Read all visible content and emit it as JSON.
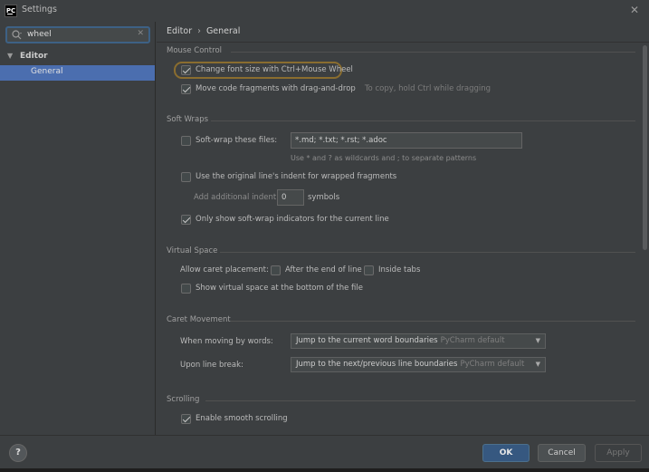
{
  "window": {
    "title": "Settings",
    "app_icon_text": "PC"
  },
  "search": {
    "value": "wheel"
  },
  "tree": {
    "editor_label": "Editor",
    "general_label": "General"
  },
  "breadcrumb": {
    "parent": "Editor",
    "current": "General"
  },
  "sections": {
    "mouse_control": {
      "title": "Mouse Control",
      "change_font_size": {
        "label": "Change font size with Ctrl+Mouse Wheel",
        "checked": true
      },
      "move_code": {
        "label": "Move code fragments with drag-and-drop",
        "checked": true,
        "hint": "To copy, hold Ctrl while dragging"
      }
    },
    "soft_wraps": {
      "title": "Soft Wraps",
      "soft_wrap_files": {
        "label": "Soft-wrap these files:",
        "checked": false,
        "value": "*.md; *.txt; *.rst; *.adoc"
      },
      "wildcard_hint": "Use * and ? as wildcards and ; to separate patterns",
      "original_indent": {
        "label": "Use the original line's indent for wrapped fragments",
        "checked": false
      },
      "additional_indent": {
        "label": "Add additional indent:",
        "value": "0",
        "unit": "symbols"
      },
      "only_show_indicators": {
        "label": "Only show soft-wrap indicators for the current line",
        "checked": true
      }
    },
    "virtual_space": {
      "title": "Virtual Space",
      "allow_caret_label": "Allow caret placement:",
      "after_end_of_line": {
        "label": "After the end of line",
        "checked": false
      },
      "inside_tabs": {
        "label": "Inside tabs",
        "checked": false
      },
      "show_virtual_space": {
        "label": "Show virtual space at the bottom of the file",
        "checked": false
      }
    },
    "caret_movement": {
      "title": "Caret Movement",
      "moving_by_words": {
        "label": "When moving by words:",
        "value": "Jump to the current word boundaries",
        "default_hint": "PyCharm default"
      },
      "upon_line_break": {
        "label": "Upon line break:",
        "value": "Jump to the next/previous line boundaries",
        "default_hint": "PyCharm default"
      }
    },
    "scrolling": {
      "title": "Scrolling",
      "smooth_scrolling": {
        "label": "Enable smooth scrolling",
        "checked": true
      }
    }
  },
  "footer": {
    "help": "?",
    "ok": "OK",
    "cancel": "Cancel",
    "apply": "Apply"
  },
  "colors": {
    "background": "#3c3f41",
    "selection": "#4b6eaf",
    "ok_button": "#365880",
    "highlight_outline": "#8a6d2f"
  }
}
